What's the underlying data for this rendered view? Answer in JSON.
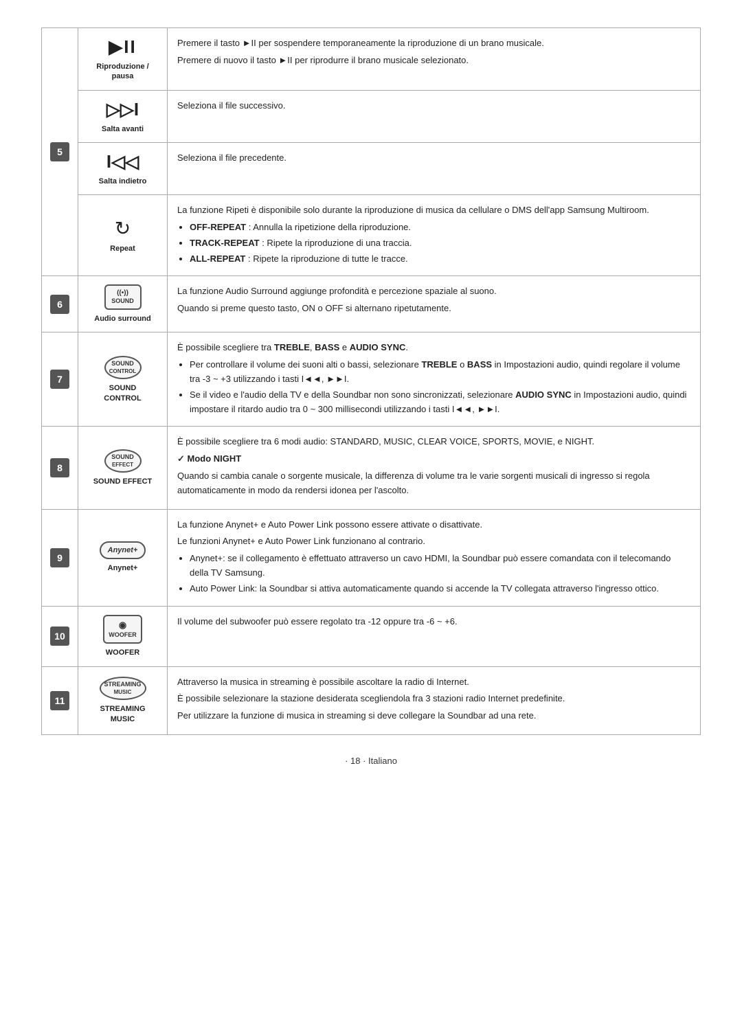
{
  "page": {
    "footer": "· 18 · Italiano"
  },
  "rows": [
    {
      "num": "5",
      "icon_label": "Riproduzione /\npausa",
      "icon_type": "play_pause",
      "desc_parts": [
        {
          "type": "text",
          "content": "Premere il tasto ►II per sospendere temporaneamente la riproduzione di un brano musicale."
        },
        {
          "type": "text",
          "content": "Premere di nuovo il tasto ►II per riprodurre il brano musicale selezionato."
        }
      ]
    },
    {
      "num": "",
      "icon_label": "Salta avanti",
      "icon_type": "skip_forward",
      "desc_parts": [
        {
          "type": "text",
          "content": "Seleziona il file successivo."
        }
      ]
    },
    {
      "num": "",
      "icon_label": "Salta indietro",
      "icon_type": "skip_back",
      "desc_parts": [
        {
          "type": "text",
          "content": "Seleziona il file precedente."
        }
      ]
    },
    {
      "num": "",
      "icon_label": "Repeat",
      "icon_type": "repeat",
      "desc_parts": [
        {
          "type": "text",
          "content": "La funzione Ripeti è disponibile solo durante la riproduzione di musica da cellulare o DMS dell'app Samsung Multiroom."
        },
        {
          "type": "bullet",
          "bold_prefix": "OFF-REPEAT",
          "content": " : Annulla la ripetizione della riproduzione."
        },
        {
          "type": "bullet",
          "bold_prefix": "TRACK-REPEAT",
          "content": " : Ripete la riproduzione di una traccia."
        },
        {
          "type": "bullet",
          "bold_prefix": "ALL-REPEAT",
          "content": " :  Ripete la riproduzione di tutte le tracce."
        }
      ]
    },
    {
      "num": "6",
      "icon_label": "Audio surround",
      "icon_type": "audio_surround",
      "desc_parts": [
        {
          "type": "text",
          "content": "La funzione Audio Surround aggiunge profondità e percezione spaziale al suono."
        },
        {
          "type": "text",
          "content": "Quando si preme questo tasto, ON o OFF si alternano ripetutamente."
        }
      ]
    },
    {
      "num": "7",
      "icon_label": "SOUND\nCONTROL",
      "icon_type": "sound_control",
      "desc_parts": [
        {
          "type": "text_bold_inline",
          "content": "È possibile scegliere tra ",
          "bold": "TREBLE",
          "mid": ", ",
          "bold2": "BASS",
          "mid2": " e ",
          "bold3": "AUDIO SYNC",
          "end": "."
        },
        {
          "type": "bullet",
          "bold_prefix": null,
          "content": "Per controllare il volume dei suoni alti o bassi, selezionare TREBLE o BASS in Impostazioni audio, quindi regolare il volume tra -3 ~ +3 utilizzando i tasti I◄◄, ►►I."
        },
        {
          "type": "bullet",
          "bold_prefix": null,
          "content": "Se il video e l'audio della TV e della Soundbar non sono sincronizzati, selezionare AUDIO SYNC in Impostazioni audio, quindi impostare il ritardo audio tra 0 ~ 300 millisecondi utilizzando i tasti I◄◄, ►►I."
        }
      ]
    },
    {
      "num": "8",
      "icon_label": "SOUND EFFECT",
      "icon_type": "sound_effect",
      "desc_parts": [
        {
          "type": "text",
          "content": "È possibile scegliere tra 6 modi audio: STANDARD, MUSIC, CLEAR VOICE, SPORTS, MOVIE, e NIGHT."
        },
        {
          "type": "check_bold",
          "content": "Modo NIGHT"
        },
        {
          "type": "text",
          "content": "Quando si cambia canale o sorgente musicale, la differenza di volume tra le varie sorgenti musicali di ingresso si regola automaticamente in modo da rendersi idonea per l'ascolto."
        }
      ]
    },
    {
      "num": "9",
      "icon_label": "Anynet+",
      "icon_type": "anynet",
      "desc_parts": [
        {
          "type": "text",
          "content": "La funzione  Anynet+ e Auto Power Link possono essere attivate o disattivate."
        },
        {
          "type": "text",
          "content": "Le funzioni Anynet+ e Auto Power Link funzionano al contrario."
        },
        {
          "type": "bullet",
          "bold_prefix": null,
          "content": "Anynet+: se il collegamento è effettuato attraverso un cavo HDMI, la Soundbar può essere comandata con il telecomando della TV Samsung."
        },
        {
          "type": "bullet",
          "bold_prefix": null,
          "content": "Auto Power Link: la Soundbar si attiva automaticamente quando si accende la TV collegata attraverso l'ingresso ottico."
        }
      ]
    },
    {
      "num": "10",
      "icon_label": "WOOFER",
      "icon_type": "woofer",
      "desc_parts": [
        {
          "type": "text",
          "content": "Il volume del subwoofer può essere regolato tra -12 oppure tra -6 ~ +6."
        }
      ]
    },
    {
      "num": "11",
      "icon_label": "STREAMING\nMUSIC",
      "icon_type": "streaming",
      "desc_parts": [
        {
          "type": "text",
          "content": "Attraverso la musica in streaming è possibile ascoltare la radio di Internet."
        },
        {
          "type": "text",
          "content": "È possibile selezionare la stazione desiderata scegliendola fra 3 stazioni radio Internet predefinite."
        },
        {
          "type": "text",
          "content": "Per utilizzare la funzione di musica in streaming si deve collegare la Soundbar ad una rete."
        }
      ]
    }
  ]
}
